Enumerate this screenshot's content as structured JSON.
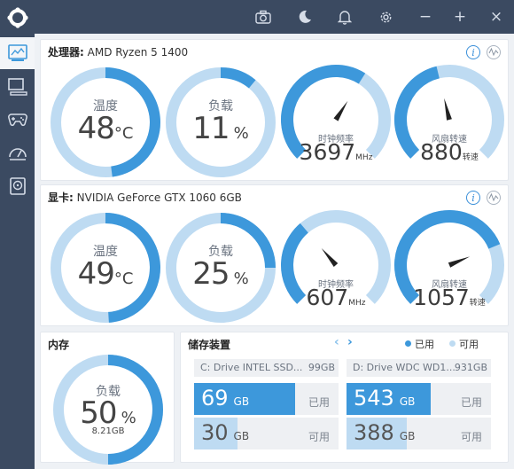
{
  "colors": {
    "accent": "#3d98db",
    "track": "#bedbf2",
    "titlebar": "#3b4a61",
    "background": "#eef1f5"
  },
  "titlebar": {
    "icons": [
      "camera-icon",
      "moon-icon",
      "bell-icon",
      "gear-icon",
      "minimize-icon",
      "maximize-icon",
      "close-icon"
    ],
    "minimize": "−",
    "maximize": "+",
    "close": "×"
  },
  "sidebar": {
    "items": [
      "dashboard-icon",
      "pc-icon",
      "gamepad-icon",
      "speed-icon",
      "disk-icon"
    ],
    "active": 0
  },
  "cpu": {
    "prefix": "处理器:",
    "name": "AMD Ryzen 5 1400",
    "temp": {
      "label": "温度",
      "value": "48",
      "unit": "°C",
      "percent": 48
    },
    "load": {
      "label": "负载",
      "value": "11",
      "unit": "%",
      "percent": 11
    },
    "clock": {
      "label": "时钟频率",
      "value": "3697",
      "unit": "MHz",
      "fraction": 0.62
    },
    "fan": {
      "label": "风扇转速",
      "value": "880",
      "unit": "转速",
      "fraction": 0.45
    }
  },
  "gpu": {
    "prefix": "显卡:",
    "name": "NVIDIA GeForce GTX 1060 6GB",
    "temp": {
      "label": "温度",
      "value": "49",
      "unit": "°C",
      "percent": 49
    },
    "load": {
      "label": "负载",
      "value": "25",
      "unit": "%",
      "percent": 25
    },
    "clock": {
      "label": "时钟频率",
      "value": "607",
      "unit": "MHz",
      "fraction": 0.35
    },
    "fan": {
      "label": "风扇转速",
      "value": "1057",
      "unit": "转速",
      "fraction": 0.75
    }
  },
  "memory": {
    "title": "内存",
    "label": "负载",
    "value": "50",
    "unit": "%",
    "sub": "8.21GB",
    "percent": 50
  },
  "storage": {
    "title": "储存装置",
    "legend_used": "已用",
    "legend_free": "可用",
    "drives": [
      {
        "name": "C: Drive INTEL SSD...",
        "size": "99GB",
        "used": "69",
        "free": "30",
        "unit": "GB",
        "used_fraction": 0.7,
        "free_fraction": 0.3,
        "used_label": "已用",
        "free_label": "可用"
      },
      {
        "name": "D: Drive WDC WD1...",
        "size": "931GB",
        "used": "543",
        "unit": "GB",
        "free": "388",
        "used_fraction": 0.58,
        "free_fraction": 0.42,
        "used_label": "已用",
        "free_label": "可用"
      }
    ]
  }
}
